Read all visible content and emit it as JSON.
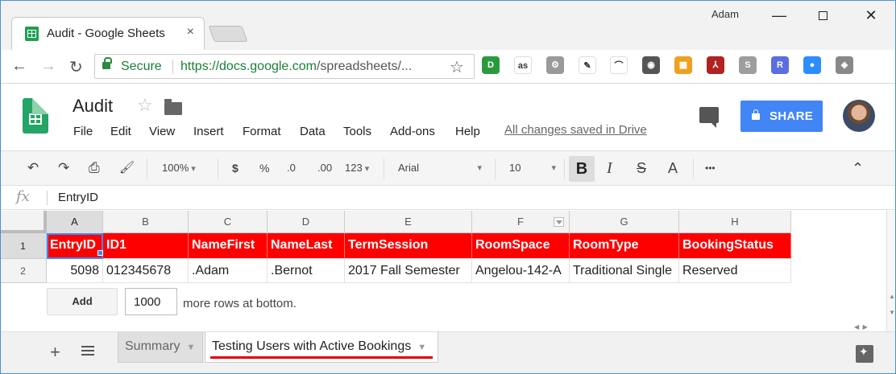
{
  "browser": {
    "tab_title": "Audit - Google Sheets",
    "tab_close": "×",
    "profile_name": "Adam",
    "win_minimize": "—",
    "win_close": "✕",
    "nav": {
      "back": "←",
      "forward": "→",
      "reload": "↻"
    },
    "secure_label": "Secure",
    "url_host": "https://docs.google.com",
    "url_path": "/spreadsheets/...",
    "bookmark_star": "☆",
    "extensions": [
      {
        "name": "1password-extension-icon",
        "color": "#2b9a3f",
        "glyph": "D"
      },
      {
        "name": "lastfm-extension-icon",
        "color": "#ffffff",
        "glyph": "as"
      },
      {
        "name": "settings-extension-icon",
        "color": "#9a9a9a",
        "glyph": "⚙"
      },
      {
        "name": "colorpicker-extension-icon",
        "color": "#ffffff",
        "glyph": "✎"
      },
      {
        "name": "rainbow-extension-icon",
        "color": "#ffffff",
        "glyph": "⌒"
      },
      {
        "name": "bulb-extension-icon",
        "color": "#555555",
        "glyph": "◉"
      },
      {
        "name": "aws-extension-icon",
        "color": "#f0a020",
        "glyph": "▦"
      },
      {
        "name": "pdf-extension-icon",
        "color": "#b22222",
        "glyph": "⅄"
      },
      {
        "name": "s-extension-icon",
        "color": "#9e9e9e",
        "glyph": "S"
      },
      {
        "name": "r-extension-icon",
        "color": "#5b6ee1",
        "glyph": "R"
      },
      {
        "name": "zoom-extension-icon",
        "color": "#2d8cff",
        "glyph": "●"
      },
      {
        "name": "shield-extension-icon",
        "color": "#888888",
        "glyph": "◈"
      }
    ]
  },
  "doc": {
    "title": "Audit",
    "star": "☆",
    "menu": [
      "File",
      "Edit",
      "View",
      "Insert",
      "Format",
      "Data",
      "Tools",
      "Add-ons",
      "Help"
    ],
    "save_status": "All changes saved in Drive",
    "share_label": "SHARE"
  },
  "toolbar": {
    "undo": "↶",
    "redo": "↷",
    "print": "⎙",
    "paint_format": "🖌",
    "zoom": "100%",
    "currency": "$",
    "percent": "%",
    "dec_decrease": ".0",
    "dec_increase": ".00",
    "more_formats": "123",
    "font": "Arial",
    "font_size": "10",
    "bold": "B",
    "italic": "I",
    "strikethrough": "S",
    "text_color": "A",
    "more": "•••",
    "collapse": "⌃"
  },
  "formula_bar": {
    "fx": "fx",
    "value": "EntryID"
  },
  "grid": {
    "columns": [
      "A",
      "B",
      "C",
      "D",
      "E",
      "F",
      "G",
      "H"
    ],
    "row_numbers": [
      "1",
      "2"
    ],
    "rows": [
      [
        "EntryID",
        "ID1",
        "NameFirst",
        "NameLast",
        "TermSession",
        "RoomSpace",
        "RoomType",
        "BookingStatus"
      ],
      [
        "5098",
        "012345678",
        ".Adam",
        ".Bernot",
        "2017 Fall Semester",
        "Angelou-142-A",
        "Traditional Single",
        "Reserved"
      ]
    ],
    "header_fill": "#ff0000",
    "add_label": "Add",
    "add_rows_value": "1000",
    "add_rows_suffix": "more rows at bottom."
  },
  "sheets": {
    "add": "+",
    "tabs": [
      {
        "label": "Summary",
        "active": false
      },
      {
        "label": "Testing Users with Active Bookings",
        "active": true
      }
    ],
    "active_underline": "#e00000"
  }
}
